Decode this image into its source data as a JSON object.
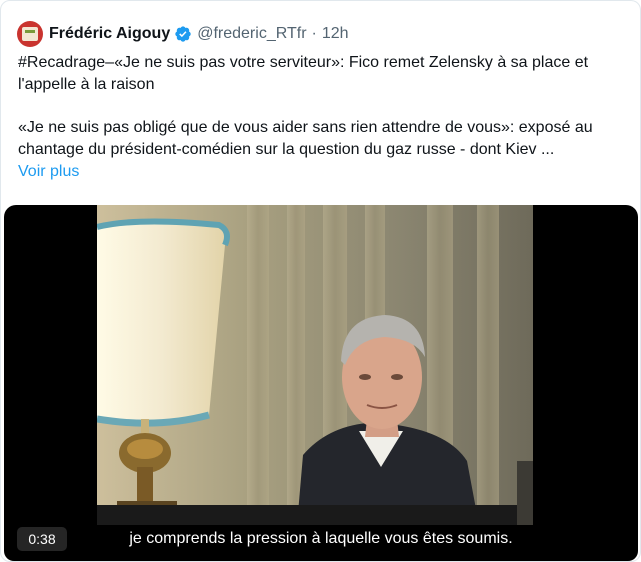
{
  "tweet": {
    "author_name": "Frédéric Aigouy",
    "handle": "@frederic_RTfr",
    "separator": "·",
    "time": "12h",
    "verified_color": "#1d9bf0",
    "text_line1": "#Recadrage–«Je ne suis pas votre serviteur»: Fico remet Zelensky à sa place et l'appelle à la raison",
    "text_line2": "«Je ne suis pas obligé que de vous aider sans rien attendre de vous»: exposé au chantage du président-comédien sur la question du gaz russe - dont Kiev ...",
    "show_more": "Voir plus"
  },
  "video": {
    "duration": "0:38",
    "subtitle": "je comprends la pression à laquelle vous êtes soumis."
  }
}
